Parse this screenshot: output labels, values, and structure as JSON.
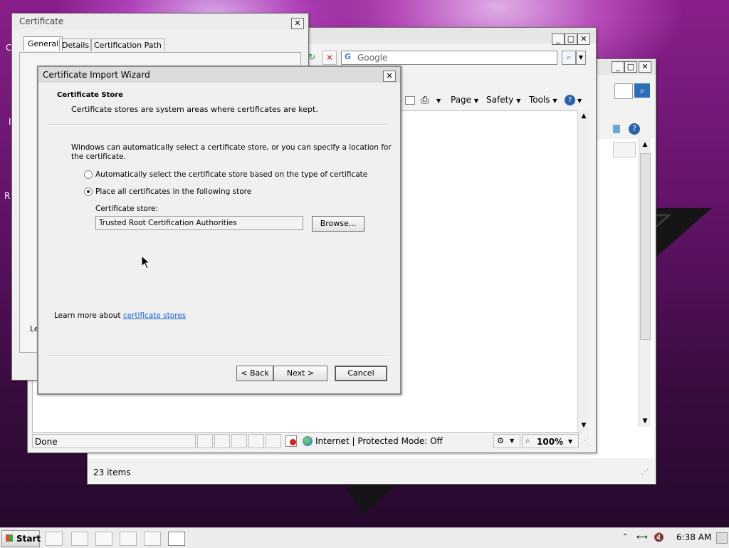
{
  "certificate": {
    "title": "Certificate",
    "tabs": [
      "General",
      "Details",
      "Certification Path"
    ],
    "left_fragment": "Le"
  },
  "ie": {
    "search_value": "Google",
    "toolbar": {
      "page": "Page",
      "safety": "Safety",
      "tools": "Tools"
    },
    "status": {
      "done": "Done",
      "zone": "Internet | Protected Mode: Off",
      "zoom": "100%"
    }
  },
  "explorer": {
    "status": "23 items"
  },
  "wizard": {
    "title": "Certificate Import Wizard",
    "heading": "Certificate Store",
    "subheading": "Certificate stores are system areas where certificates are kept.",
    "description_line1": "Windows can automatically select a certificate store, or you can specify a location for",
    "description_line2": "the certificate.",
    "radio_auto": "Automatically select the certificate store based on the type of certificate",
    "radio_place": "Place all certificates in the following store",
    "store_label": "Certificate store:",
    "store_value": "Trusted Root Certification Authorities",
    "browse": "Browse...",
    "learn_prefix": "Learn more about ",
    "learn_link": "certificate stores",
    "back": "< Back",
    "next": "Next >",
    "cancel": "Cancel"
  },
  "taskbar": {
    "start": "Start",
    "clock": "6:38 AM"
  },
  "desktop_fragments": [
    "C",
    "I",
    "R"
  ],
  "colors": {
    "link": "#1a64c8",
    "title_bg": "#e6e6e6",
    "desktop_purple": "#8a1f8c"
  }
}
